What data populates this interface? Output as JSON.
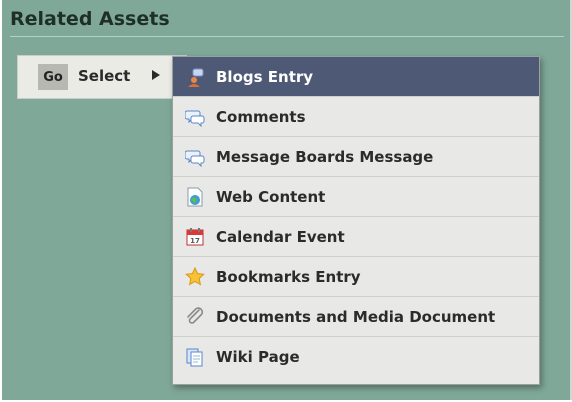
{
  "section": {
    "title": "Related Assets"
  },
  "toolbar": {
    "go_label": "Go",
    "select_label": "Select"
  },
  "menu": {
    "items": [
      {
        "label": "Blogs Entry",
        "icon": "blogs-entry-icon",
        "active": true
      },
      {
        "label": "Comments",
        "icon": "comments-icon"
      },
      {
        "label": "Message Boards Message",
        "icon": "message-boards-icon"
      },
      {
        "label": "Web Content",
        "icon": "web-content-icon"
      },
      {
        "label": "Calendar Event",
        "icon": "calendar-icon"
      },
      {
        "label": "Bookmarks Entry",
        "icon": "bookmarks-star-icon"
      },
      {
        "label": "Documents and Media Document",
        "icon": "paperclip-icon"
      },
      {
        "label": "Wiki Page",
        "icon": "wiki-page-icon"
      }
    ]
  },
  "colors": {
    "background": "#7fa899",
    "active_item": "#4e5a75",
    "menu": "#e8e8e6"
  }
}
